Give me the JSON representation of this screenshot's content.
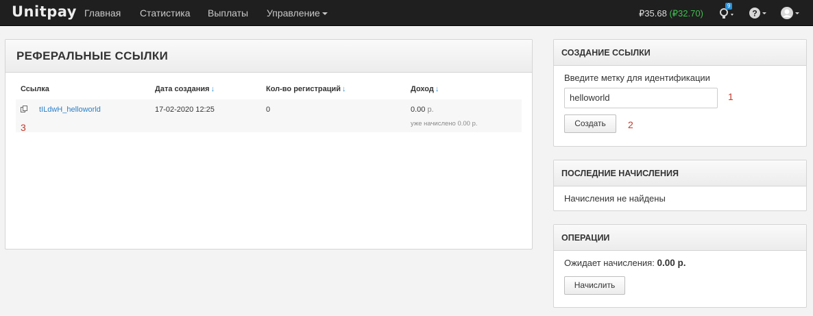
{
  "navbar": {
    "logo": "Unitpay",
    "items": [
      "Главная",
      "Статистика",
      "Выплаты",
      "Управление"
    ],
    "balance_main": "₽35.68",
    "balance_secondary": "(₽32.70)",
    "notification_count": "9"
  },
  "referral_panel": {
    "title": "РЕФЕРАЛЬНЫЕ ССЫЛКИ",
    "columns": [
      "Ссылка",
      "Дата создания",
      "Кол-во регистраций",
      "Доход"
    ],
    "rows": [
      {
        "link": "tILdwH_helloworld",
        "created": "17-02-2020 12:25",
        "registrations": "0",
        "income_value": "0.00",
        "income_currency": "р.",
        "accrued_note": "уже начислено 0.00 р."
      }
    ]
  },
  "create_link_panel": {
    "title": "СОЗДАНИЕ ССЫЛКИ",
    "label": "Введите метку для идентификации",
    "input_value": "helloworld",
    "button": "Создать"
  },
  "recent_panel": {
    "title": "ПОСЛЕДНИЕ НАЧИСЛЕНИЯ",
    "empty_text": "Начисления не найдены"
  },
  "operations_panel": {
    "title": "ОПЕРАЦИИ",
    "pending_label": "Ожидает начисления:",
    "pending_value": "0.00 р.",
    "button": "Начислить"
  },
  "annotations": [
    "1",
    "2",
    "3"
  ]
}
